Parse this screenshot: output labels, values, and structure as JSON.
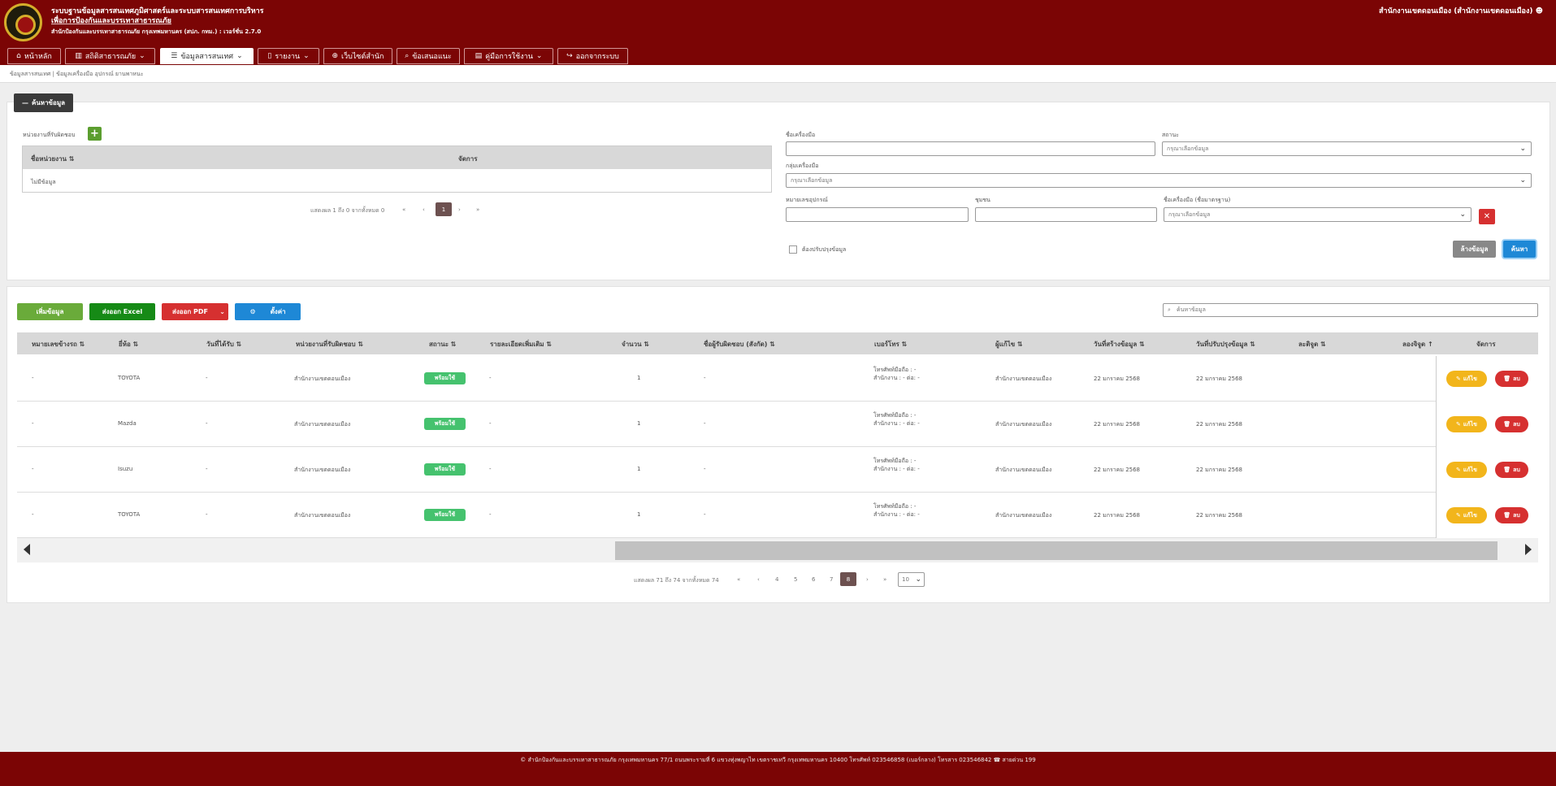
{
  "header": {
    "title_line1": "ระบบฐานข้อมูลสารสนเทศภูมิศาสตร์และระบบสารสนเทศการบริหาร",
    "title_line2": "เพื่อการป้องกันและบรรเทาสาธารณภัย",
    "subtitle": "สำนักป้องกันและบรรเทาสาธารณภัย กรุงเทพมหานคร (สปภ. กทม.) : เวอร์ชั่น 2.7.0",
    "user": "สำนักงานเขตดอนเมือง (สำนักงานเขตดอนเมือง)"
  },
  "nav": [
    {
      "label": "หน้าหลัก",
      "icon": "home-icon"
    },
    {
      "label": "สถิติสาธารณภัย",
      "icon": "chart-icon"
    },
    {
      "label": "ข้อมูลสารสนเทศ",
      "icon": "list-icon"
    },
    {
      "label": "รายงาน",
      "icon": "file-icon"
    },
    {
      "label": "เว็บไซต์สำนัก",
      "icon": "globe-icon"
    },
    {
      "label": "ข้อเสนอแนะ",
      "icon": "search-icon"
    },
    {
      "label": "คู่มือการใช้งาน",
      "icon": "book-icon"
    },
    {
      "label": "ออกจากระบบ",
      "icon": "logout-icon"
    }
  ],
  "breadcrumb": "ข้อมูลสารสนเทศ | ข้อมูลเครื่องมือ อุปกรณ์ ยานพาหนะ",
  "search_panel": {
    "toggle_label": "ค้นหาข้อมูล",
    "unit_label": "หน่วยงานที่รับผิดชอบ",
    "unit_table": {
      "col_name": "ชื่อหน่วยงาน",
      "col_action": "จัดการ",
      "empty": "ไม่มีข้อมูล"
    },
    "unit_pager": {
      "summary": "แสดงผล 1 ถึง 0 จากทั้งหมด 0",
      "page": "1"
    },
    "tool_name_label": "ชื่อเครื่องมือ",
    "status_label": "สถานะ",
    "status_placeholder": "กรุณาเลือกข้อมูล",
    "group_label": "กลุ่มเครื่องมือ",
    "group_placeholder": "กรุณาเลือกข้อมูล",
    "serial_label": "หมายเลขอุปกรณ์",
    "community_label": "ชุมชน",
    "std_name_label": "ชื่อเครื่องมือ (ชื่อมาตรฐาน)",
    "std_name_placeholder": "กรุณาเลือกข้อมูล",
    "clear_icon_label": "✕",
    "checkbox_label": "ต้องปรับปรุงข้อมูล",
    "reset_label": "ล้างข้อมูล",
    "search_label": "ค้นหา"
  },
  "toolbar": {
    "add_label": "เพิ่มข้อมูล",
    "excel_label": "ส่งออก Excel",
    "pdf_label": "ส่งออก PDF",
    "settings_label": "ตั้งค่า",
    "search_placeholder": "ค้นหาข้อมูล"
  },
  "table": {
    "columns": [
      "หมายเลขข้างรถ",
      "ยี่ห้อ",
      "วันที่ได้รับ",
      "หน่วยงานที่รับผิดชอบ",
      "สถานะ",
      "รายละเอียดเพิ่มเติม",
      "จำนวน",
      "ชื่อผู้รับผิดชอบ (สังกัด)",
      "เบอร์โทร",
      "ผู้แก้ไข",
      "วันที่สร้างข้อมูล",
      "วันที่ปรับปรุงข้อมูล",
      "ละติจูด",
      "ลองจิจูด",
      "จัดการ"
    ],
    "rows": [
      {
        "plate": "-",
        "brand": "TOYOTA",
        "date": "-",
        "unit": "สำนักงานเขตดอนเมือง",
        "status": "พร้อมใช้",
        "detail": "-",
        "qty": "1",
        "owner": "-",
        "phone1": "โทรศัพท์มือถือ : -",
        "phone2": "สำนักงาน : - ต่อ: -",
        "editor": "สำนักงานเขตดอนเมือง",
        "created": "22 มกราคม 2568",
        "updated": "22 มกราคม 2568"
      },
      {
        "plate": "-",
        "brand": "Mazda",
        "date": "-",
        "unit": "สำนักงานเขตดอนเมือง",
        "status": "พร้อมใช้",
        "detail": "-",
        "qty": "1",
        "owner": "-",
        "phone1": "โทรศัพท์มือถือ : -",
        "phone2": "สำนักงาน : - ต่อ: -",
        "editor": "สำนักงานเขตดอนเมือง",
        "created": "22 มกราคม 2568",
        "updated": "22 มกราคม 2568"
      },
      {
        "plate": "-",
        "brand": "Isuzu",
        "date": "-",
        "unit": "สำนักงานเขตดอนเมือง",
        "status": "พร้อมใช้",
        "detail": "-",
        "qty": "1",
        "owner": "-",
        "phone1": "โทรศัพท์มือถือ : -",
        "phone2": "สำนักงาน : - ต่อ: -",
        "editor": "สำนักงานเขตดอนเมือง",
        "created": "22 มกราคม 2568",
        "updated": "22 มกราคม 2568"
      },
      {
        "plate": "-",
        "brand": "TOYOTA",
        "date": "-",
        "unit": "สำนักงานเขตดอนเมือง",
        "status": "พร้อมใช้",
        "detail": "-",
        "qty": "1",
        "owner": "-",
        "phone1": "โทรศัพท์มือถือ : -",
        "phone2": "สำนักงาน : - ต่อ: -",
        "editor": "สำนักงานเขตดอนเมือง",
        "created": "22 มกราคม 2568",
        "updated": "22 มกราคม 2568"
      }
    ],
    "edit_label": "แก้ไข",
    "delete_label": "ลบ"
  },
  "pager": {
    "summary": "แสดงผล 71 ถึง 74 จากทั้งหมด 74",
    "pages": [
      "4",
      "5",
      "6",
      "7",
      "8"
    ],
    "current": "8",
    "page_size": "10"
  },
  "footer": "© สำนักป้องกันและบรรเทาสาธารณภัย กรุงเทพมหานคร 77/1 ถนนพระรามที่ 6 แขวงทุ่งพญาไท เขตราชเทวี กรุงเทพมหานคร 10400 โทรศัพท์ 023546858 (เบอร์กลาง) โทรสาร 023546842 ☎ สายด่วน 199",
  "colors": {
    "brand": "#7b0505",
    "success": "#45c26e",
    "warning": "#f2b51b",
    "danger": "#d63030",
    "primary": "#1e88d6"
  }
}
